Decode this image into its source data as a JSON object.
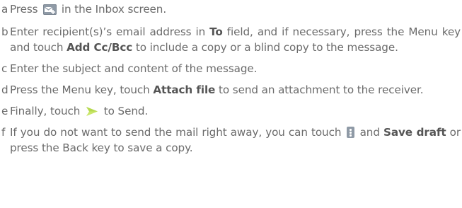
{
  "colors": {
    "text": "#6b6b6b",
    "bold_text": "#555555",
    "icon_gray": "#8f9aa6",
    "send_arrow": "#c9e66a"
  },
  "icons": {
    "compose": "compose-mail-icon",
    "send": "send-arrow-icon",
    "menu": "overflow-menu-icon"
  },
  "steps": [
    {
      "marker": "a",
      "before": "Press ",
      "after": " in the Inbox screen."
    },
    {
      "marker": "b",
      "t1": "Enter recipient(s)’s email address in ",
      "b1": "To",
      "t2": " field, and if necessary, press the Menu key and touch ",
      "b2": "Add Cc/Bcc",
      "t3": " to include a copy or a blind copy to the message."
    },
    {
      "marker": "c",
      "text": "Enter the subject and content of the message."
    },
    {
      "marker": "d",
      "t1": "Press the Menu key, touch ",
      "b1": "Attach file",
      "t2": " to send an attachment to the receiver."
    },
    {
      "marker": "e",
      "before": "Finally, touch ",
      "after": " to Send."
    },
    {
      "marker": "f",
      "t1": "If you do not want to send the mail right away, you can touch ",
      "t2": " and ",
      "b1": "Save draft",
      "t3": " or press the Back key to save a copy."
    }
  ]
}
